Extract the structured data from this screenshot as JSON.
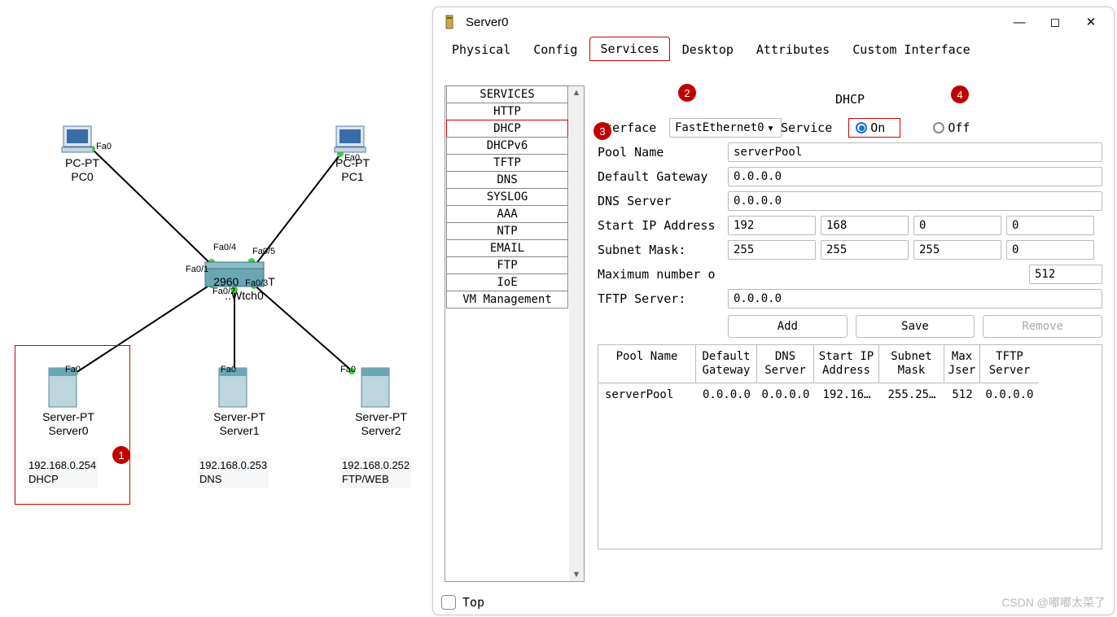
{
  "topology": {
    "devices": {
      "pc0": {
        "type": "PC-PT",
        "name": "PC0",
        "port": "Fa0"
      },
      "pc1": {
        "type": "PC-PT",
        "name": "PC1",
        "port": "Fa0"
      },
      "switch": {
        "name": "Switch0",
        "model": "2960",
        "ports": [
          "Fa0/1",
          "Fa0/2",
          "Fa0/3",
          "Fa0/4",
          "Fa0/5"
        ]
      },
      "server0": {
        "type": "Server-PT",
        "name": "Server0",
        "port": "Fa0",
        "ip": "192.168.0.254",
        "role": "DHCP"
      },
      "server1": {
        "type": "Server-PT",
        "name": "Server1",
        "port": "Fa0",
        "ip": "192.168.0.253",
        "role": "DNS"
      },
      "server2": {
        "type": "Server-PT",
        "name": "Server2",
        "port": "Fa0",
        "ip": "192.168.0.252",
        "role": "FTP/WEB"
      }
    },
    "switch_label_partial": "tch0",
    "callouts": {
      "1": "1",
      "2": "2",
      "3": "3",
      "4": "4"
    }
  },
  "window": {
    "title": "Server0",
    "tabs": [
      "Physical",
      "Config",
      "Services",
      "Desktop",
      "Attributes",
      "Custom Interface"
    ],
    "active_tab": "Services",
    "services_list": [
      "SERVICES",
      "HTTP",
      "DHCP",
      "DHCPv6",
      "TFTP",
      "DNS",
      "SYSLOG",
      "AAA",
      "NTP",
      "EMAIL",
      "FTP",
      "IoE",
      "VM Management"
    ],
    "selected_service": "DHCP",
    "dhcp": {
      "title": "DHCP",
      "interface_label": "nterface",
      "interface_value": "FastEthernet0",
      "service_label": "Service",
      "on_label": "On",
      "off_label": "Off",
      "service_on": true,
      "pool_name_label": "Pool Name",
      "pool_name": "serverPool",
      "default_gw_label": "Default Gateway",
      "default_gw": "0.0.0.0",
      "dns_label": "DNS Server",
      "dns": "0.0.0.0",
      "start_ip_label": "Start IP Address",
      "start_ip": [
        "192",
        "168",
        "0",
        "0"
      ],
      "subnet_label": "Subnet Mask:",
      "subnet": [
        "255",
        "255",
        "255",
        "0"
      ],
      "max_label": "Maximum number o",
      "max_value": "512",
      "tftp_label": "TFTP Server:",
      "tftp": "0.0.0.0",
      "buttons": {
        "add": "Add",
        "save": "Save",
        "remove": "Remove"
      },
      "table": {
        "headers": [
          "Pool Name",
          "Default Gateway",
          "DNS Server",
          "Start IP Address",
          "Subnet Mask",
          "Max User",
          "TFTP Server"
        ],
        "header_max_visible": "Max Jser",
        "row": {
          "pool": "serverPool",
          "gw": "0.0.0.0",
          "dns": "0.0.0.0",
          "sip": "192.16…",
          "sm": "255.25…",
          "mu": "512",
          "tftp": "0.0.0.0"
        }
      }
    },
    "bottom": {
      "top": "Top"
    }
  },
  "watermark": "CSDN @嘟嘟太菜了"
}
